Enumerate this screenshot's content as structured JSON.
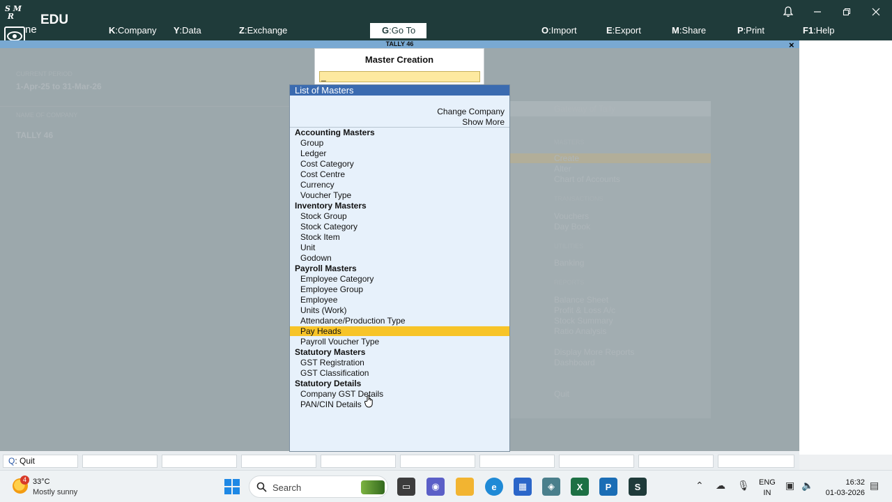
{
  "topbar": {
    "edition": "EDU",
    "name_fragment": "ne",
    "menus": [
      {
        "key": "K",
        "label": ":Company"
      },
      {
        "key": "Y",
        "label": ":Data"
      },
      {
        "key": "Z",
        "label": ":Exchange"
      },
      {
        "key": "G",
        "label": ":Go To"
      },
      {
        "key": "O",
        "label": ":Import"
      },
      {
        "key": "E",
        "label": ":Export"
      },
      {
        "key": "M",
        "label": ":Share"
      },
      {
        "key": "P",
        "label": ":Print"
      },
      {
        "key": "F1",
        "label": ":Help"
      }
    ],
    "window_controls": [
      "bell-icon",
      "minimize-icon",
      "restore-icon",
      "close-icon"
    ]
  },
  "title_strip": {
    "text": "TALLY 46",
    "close_glyph": "×"
  },
  "gateway": {
    "current_period_label": "CURRENT PERIOD",
    "current_period": "1-Apr-25 to 31-Mar-26",
    "company_label": "NAME OF COMPANY",
    "company": "TALLY 46",
    "panel_title": "Gateway of Tally",
    "sections": [
      {
        "heading": "MASTERS",
        "items": [
          "Create",
          "Alter",
          "Chart of Accounts"
        ]
      },
      {
        "heading": "TRANSACTIONS",
        "items": [
          "Vouchers",
          "Day Book"
        ]
      },
      {
        "heading": "UTILITIES",
        "items": [
          "Banking"
        ]
      },
      {
        "heading": "REPORTS",
        "items": [
          "Balance Sheet",
          "Profit & Loss A/c",
          "Stock Summary",
          "Ratio Analysis"
        ]
      },
      {
        "heading": "",
        "items": [
          "Display More Reports",
          "Dashboard"
        ]
      },
      {
        "heading": "",
        "items": [
          "Quit"
        ]
      }
    ]
  },
  "master_creation": {
    "title": "Master Creation",
    "input_value": "_"
  },
  "list_of_masters": {
    "title": "List of Masters",
    "actions": [
      "Change Company",
      "Show More"
    ],
    "groups": [
      {
        "heading": "Accounting Masters",
        "items": [
          "Group",
          "Ledger",
          "Cost Category",
          "Cost Centre",
          "Currency",
          "Voucher Type"
        ]
      },
      {
        "heading": "Inventory Masters",
        "items": [
          "Stock Group",
          "Stock Category",
          "Stock Item",
          "Unit",
          "Godown"
        ]
      },
      {
        "heading": "Payroll Masters",
        "items": [
          "Employee Category",
          "Employee Group",
          "Employee",
          "Units (Work)",
          "Attendance/Production Type",
          "Pay Heads",
          "Payroll Voucher Type"
        ]
      },
      {
        "heading": "Statutory Masters",
        "items": [
          "GST Registration",
          "GST Classification"
        ]
      },
      {
        "heading": "Statutory Details",
        "items": [
          "Company GST Details",
          "PAN/CIN Details"
        ]
      }
    ],
    "selected_item": "Pay Heads",
    "selected_color": "#f7c428",
    "header_color": "#3b6bb0"
  },
  "bottombar": {
    "quit_key": "Q",
    "quit_label": ": Quit"
  },
  "taskbar": {
    "weather_badge": "4",
    "weather_temp": "33°C",
    "weather_desc": "Mostly sunny",
    "search_placeholder": "Search",
    "apps": [
      "file-explorer-icon",
      "teams-icon",
      "folder-icon",
      "edge-icon",
      "store-icon",
      "app-icon",
      "excel-icon",
      "tallyprime-icon",
      "tally-edu-icon"
    ],
    "lang_line1": "ENG",
    "lang_line2": "IN",
    "time": "16:32",
    "date": "01-03-2026"
  }
}
